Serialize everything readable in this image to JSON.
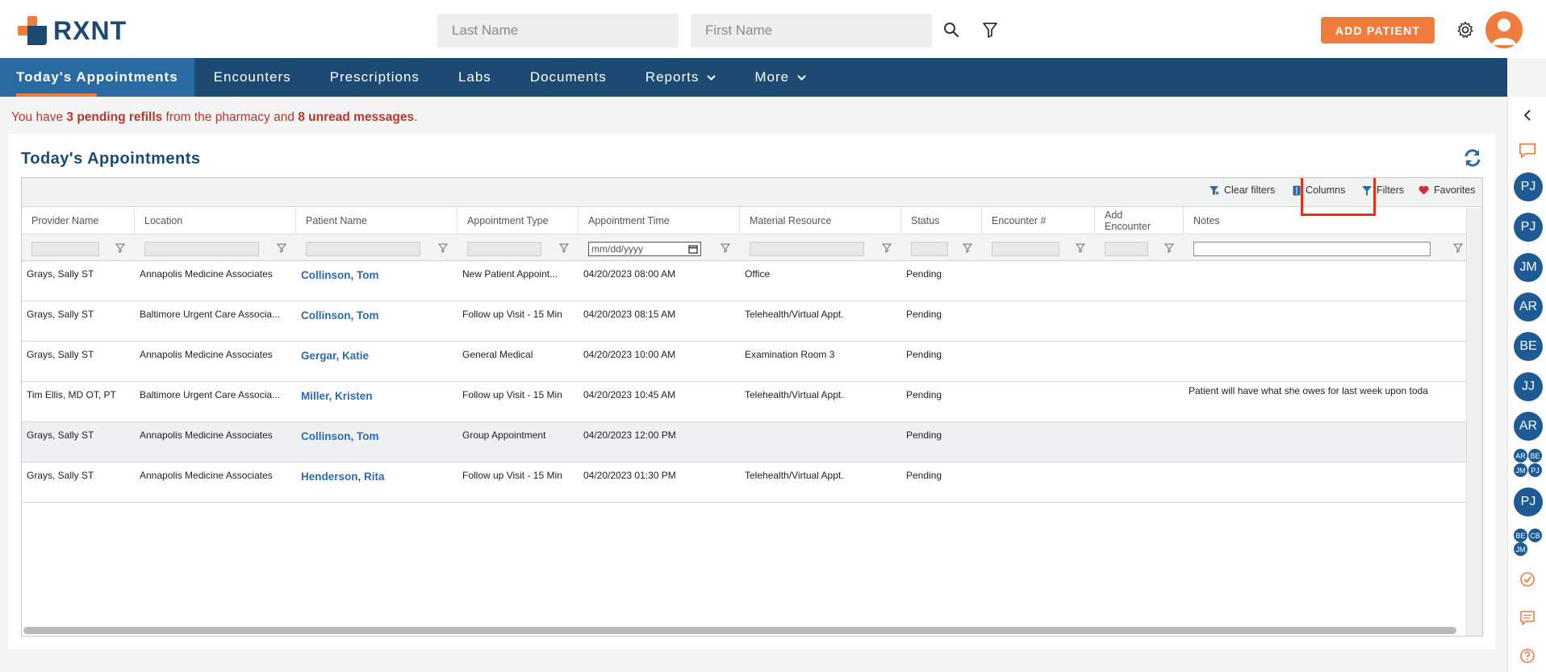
{
  "brand": {
    "name": "RXNT"
  },
  "header": {
    "last_name_placeholder": "Last Name",
    "first_name_placeholder": "First Name",
    "add_patient_label": "ADD PATIENT"
  },
  "nav": {
    "items": [
      {
        "label": "Today's Appointments"
      },
      {
        "label": "Encounters"
      },
      {
        "label": "Prescriptions"
      },
      {
        "label": "Labs"
      },
      {
        "label": "Documents"
      },
      {
        "label": "Reports"
      },
      {
        "label": "More"
      }
    ]
  },
  "alert": {
    "prefix": "You have ",
    "refills": "3 pending refills",
    "middle": " from the pharmacy and ",
    "messages": "8 unread messages",
    "suffix": "."
  },
  "panel": {
    "title": "Today's Appointments",
    "toolbar": {
      "clear_filters": "Clear filters",
      "columns": "Columns",
      "filters": "Filters",
      "favorites": "Favorites"
    },
    "date_placeholder": "mm/dd/yyyy",
    "columns": [
      "Provider Name",
      "Location",
      "Patient Name",
      "Appointment Type",
      "Appointment Time",
      "Material Resource",
      "Status",
      "Encounter #",
      "Add Encounter",
      "Notes"
    ],
    "rows": [
      {
        "provider": "Grays, Sally ST",
        "location": "Annapolis Medicine Associates",
        "patient": "Collinson, Tom",
        "type": "New Patient Appoint...",
        "time": "04/20/2023 08:00 AM",
        "resource": "Office",
        "status": "Pending",
        "notes": ""
      },
      {
        "provider": "Grays, Sally ST",
        "location": "Baltimore Urgent Care Associa...",
        "patient": "Collinson, Tom",
        "type": "Follow up Visit - 15 Min",
        "time": "04/20/2023 08:15 AM",
        "resource": "Telehealth/Virtual Appt.",
        "status": "Pending",
        "notes": ""
      },
      {
        "provider": "Grays, Sally ST",
        "location": "Annapolis Medicine Associates",
        "patient": "Gergar, Katie",
        "type": "General Medical",
        "time": "04/20/2023 10:00 AM",
        "resource": "Examination Room 3",
        "status": "Pending",
        "notes": ""
      },
      {
        "provider": "Tim Ellis, MD OT, PT",
        "location": "Baltimore Urgent Care Associa...",
        "patient": "Miller, Kristen",
        "type": "Follow up Visit - 15 Min",
        "time": "04/20/2023 10:45 AM",
        "resource": "Telehealth/Virtual Appt.",
        "status": "Pending",
        "notes": "Patient will have what she owes for last week upon toda"
      },
      {
        "provider": "Grays, Sally ST",
        "location": "Annapolis Medicine Associates",
        "patient": "Collinson, Tom",
        "type": "Group Appointment",
        "time": "04/20/2023 12:00 PM",
        "resource": "",
        "status": "Pending",
        "notes": ""
      },
      {
        "provider": "Grays, Sally ST",
        "location": "Annapolis Medicine Associates",
        "patient": "Henderson, Rita",
        "type": "Follow up Visit - 15 Min",
        "time": "04/20/2023 01:30 PM",
        "resource": "Telehealth/Virtual Appt.",
        "status": "Pending",
        "notes": ""
      }
    ]
  },
  "sidebar": {
    "chips": [
      "PJ",
      "PJ",
      "JM",
      "AR",
      "BE",
      "JJ",
      "AR"
    ],
    "group_a": [
      "AR",
      "BE",
      "JM",
      "PJ"
    ],
    "chip_pj2": "PJ",
    "group_b": [
      "BE",
      "CB",
      "JM"
    ]
  },
  "colors": {
    "brand_navy": "#1c4a72",
    "accent_orange": "#f07c3e",
    "nav_active": "#2a6aa3",
    "link_blue": "#2f6aa8",
    "alert_red": "#b3372b"
  }
}
